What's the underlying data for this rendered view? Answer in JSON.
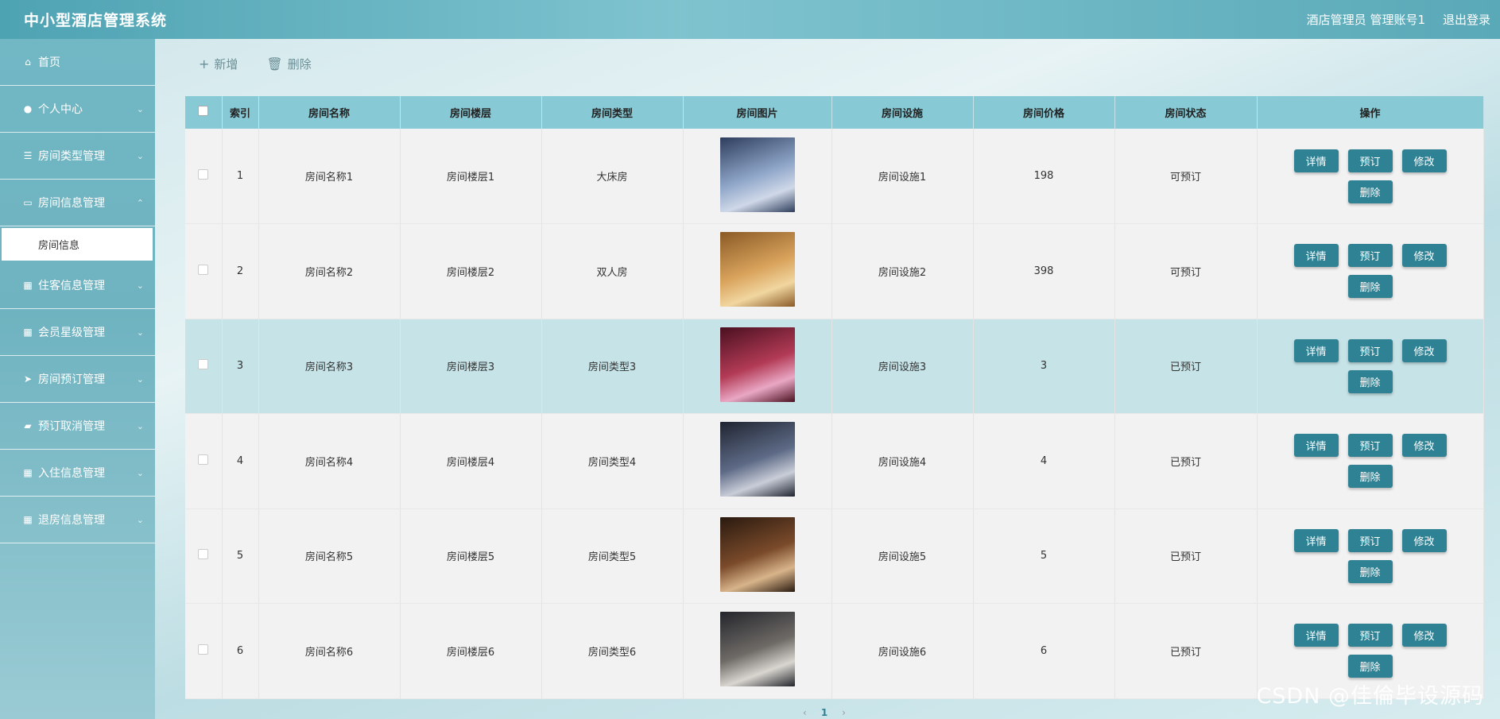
{
  "header": {
    "title": "中小型酒店管理系统",
    "user_label": "酒店管理员 管理账号1",
    "logout_label": "退出登录"
  },
  "sidebar": {
    "items": [
      {
        "label": "首页",
        "icon": "home-icon"
      },
      {
        "label": "个人中心",
        "icon": "user-icon"
      },
      {
        "label": "房间类型管理",
        "icon": "sliders-icon"
      },
      {
        "label": "房间信息管理",
        "icon": "monitor-icon"
      },
      {
        "label": "房间信息",
        "icon": ""
      },
      {
        "label": "住客信息管理",
        "icon": "grid-icon"
      },
      {
        "label": "会员星级管理",
        "icon": "grid-icon"
      },
      {
        "label": "房间预订管理",
        "icon": "send-icon"
      },
      {
        "label": "预订取消管理",
        "icon": "ticket-icon"
      },
      {
        "label": "入住信息管理",
        "icon": "grid-icon"
      },
      {
        "label": "退房信息管理",
        "icon": "grid-icon"
      }
    ]
  },
  "toolbar": {
    "add_label": "新增",
    "delete_label": "删除"
  },
  "table": {
    "headers": [
      "索引",
      "房间名称",
      "房间楼层",
      "房间类型",
      "房间图片",
      "房间设施",
      "房间价格",
      "房间状态",
      "操作"
    ],
    "rows": [
      {
        "index": "1",
        "name": "房间名称1",
        "floor": "房间楼层1",
        "type": "大床房",
        "facility": "房间设施1",
        "price": "198",
        "status": "可预订",
        "image_colors": [
          "#2e3d5c",
          "#8fa6c9",
          "#cfd8e8"
        ]
      },
      {
        "index": "2",
        "name": "房间名称2",
        "floor": "房间楼层2",
        "type": "双人房",
        "facility": "房间设施2",
        "price": "398",
        "status": "可预订",
        "image_colors": [
          "#8a5a26",
          "#d9a35c",
          "#f1d6a0"
        ]
      },
      {
        "index": "3",
        "name": "房间名称3",
        "floor": "房间楼层3",
        "type": "房间类型3",
        "facility": "房间设施3",
        "price": "3",
        "status": "已预订",
        "image_colors": [
          "#4a1020",
          "#b23a55",
          "#e9a7c4"
        ]
      },
      {
        "index": "4",
        "name": "房间名称4",
        "floor": "房间楼层4",
        "type": "房间类型4",
        "facility": "房间设施4",
        "price": "4",
        "status": "已预订",
        "image_colors": [
          "#1f2430",
          "#5d6a86",
          "#c9cdd8"
        ]
      },
      {
        "index": "5",
        "name": "房间名称5",
        "floor": "房间楼层5",
        "type": "房间类型5",
        "facility": "房间设施5",
        "price": "5",
        "status": "已预订",
        "image_colors": [
          "#2a1a10",
          "#7a4a2a",
          "#d8b48a"
        ]
      },
      {
        "index": "6",
        "name": "房间名称6",
        "floor": "房间楼层6",
        "type": "房间类型6",
        "facility": "房间设施6",
        "price": "6",
        "status": "已预订",
        "image_colors": [
          "#23252b",
          "#6e6a66",
          "#d9d6d0"
        ]
      }
    ],
    "actions": {
      "detail": "详情",
      "book": "预订",
      "edit": "修改",
      "delete": "删除"
    }
  },
  "pagination": {
    "prev": "‹",
    "current": "1",
    "next": "›"
  },
  "watermark": "CSDN @佳倫毕设源码"
}
